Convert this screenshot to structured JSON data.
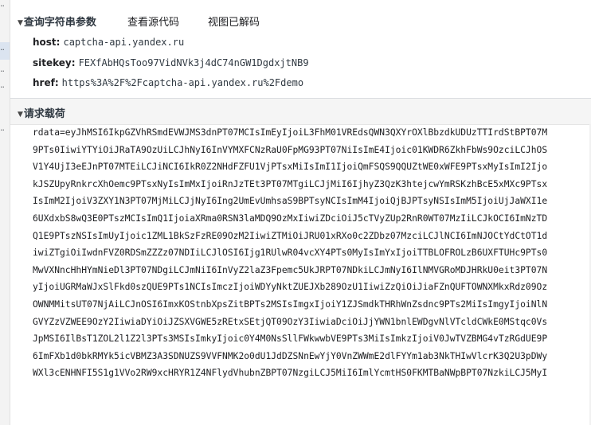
{
  "query_string": {
    "title": "查询字符串参数",
    "view_source_label": "查看源代码",
    "view_decoded_label": "视图已解码",
    "params": [
      {
        "key": "host:",
        "value": "captcha-api.yandex.ru"
      },
      {
        "key": "sitekey:",
        "value": "FEXfAbHQsToo97VidNVk3j4dC74nGW1DgdxjtNB9"
      },
      {
        "key": "href:",
        "value": "https%3A%2F%2Fcaptcha-api.yandex.ru%2Fdemo"
      }
    ]
  },
  "payload": {
    "title": "请求载荷",
    "lines": [
      "rdata=eyJhMSI6IkpGZVhRSmdEVWJMS3dnPT07MCIsImEyIjoiL3FhM01VREdsQWN3QXYrOXlBbzdkUDUzTTIrdStBPT07M",
      "9PTs0IiwiYTYiOiJRaTA9OzUiLCJhNyI6InVYMXFCNzRaU0FpMG93PT07NiIsImE4Ijoic01KWDR6ZkhFbWs9OzciLCJhOS",
      "V1Y4UjI3eEJnPT07MTEiLCJiNCI6IkR0Z2NHdFZFU1VjPTsxMiIsImI1IjoiQmFSQS9QQUZtWE0xWFE9PTsxMyIsImI2Ijo",
      "kJSZUpyRnkrcXhOemc9PTsxNyIsImMxIjoiRnJzTEt3PT07MTgiLCJjMiI6IjhyZ3QzK3htejcwYmRSKzhBcE5xMXc9PTsx",
      "IsImM2IjoiV3ZXY1N3PT07MjMiLCJjNyI6Ing2UmEvUmhsaS9BPTsyNCIsImM4IjoiQjBJPTsyNSIsImM5IjoiUjJaWXI1e",
      "6UXdxbS8wQ3E0PTszMCIsImQ1IjoiaXRma0RSN3laMDQ9OzMxIiwiZDciOiJ5cTVyZUp2RnR0WT07MzIiLCJkOCI6ImNzTD",
      "Q1E9PTszNSIsImUyIjoic1ZML1BkSzFzRE09OzM2IiwiZTMiOiJRU01xRXo0c2ZDbz07MzciLCJlNCI6ImNJOCtYdCtOT1d",
      "iwiZTgiOiIwdnFVZ0RDSmZZZz07NDIiLCJlOSI6Ijg1RUlwR04vcXY4PTs0MyIsImYxIjoiTTBLOFROLzB6UXFTUHc9PTs0",
      "MwVXNncHhHYmNieDl3PT07NDgiLCJmNiI6InVyZ2laZ3Fpemc5UkJRPT07NDkiLCJmNyI6IlNMVGRoMDJHRkU0eit3PT07N",
      "yIjoiUGRMaWJxSlFkd0szQUE9PTs1NCIsImczIjoiWDYyNktZUEJXb289OzU1IiwiZzQiOiJiaFZnQUFTOWNXMkxRdz09Oz",
      "OWNMMitsUT07NjAiLCJnOSI6ImxKOStnbXpsZitBPTs2MSIsImgxIjoiY1ZJSmdkTHRhWnZsdnc9PTs2MiIsImgyIjoiNlN",
      "GVYZzVZWEE9OzY2IiwiaDYiOiJZSXVGWE5zREtxSEtjQT09OzY3IiwiaDciOiJjYWN1bnlEWDgvNlVTcldCWkE0MStqc0Vs",
      "JpMSI6IlBsT1ZOL2l1Z2l3PTs3MSIsImkyIjoic0Y4M0NsSllFWkwwbVE9PTs3MiIsImkzIjoiV0JwTVZBMG4vTzRGdUE9P",
      "6ImFXb1d0bkRMYk5icVBMZ3A3SDNUZS9VVFNMK2o0dU1JdDZSNnEwYjY0VnZWWmE2dlFYYm1ab3NkTHIwVlcrK3Q2U3pDWy",
      "WXl3cENHNFI5S1g1VVo2RW9xcHRYR1Z4NFlydVhubnZBPT07NzgiLCJ5MiI6ImlYcmtHS0FKMTBaNWpBPT07NzkiLCJ5MyI"
    ]
  }
}
